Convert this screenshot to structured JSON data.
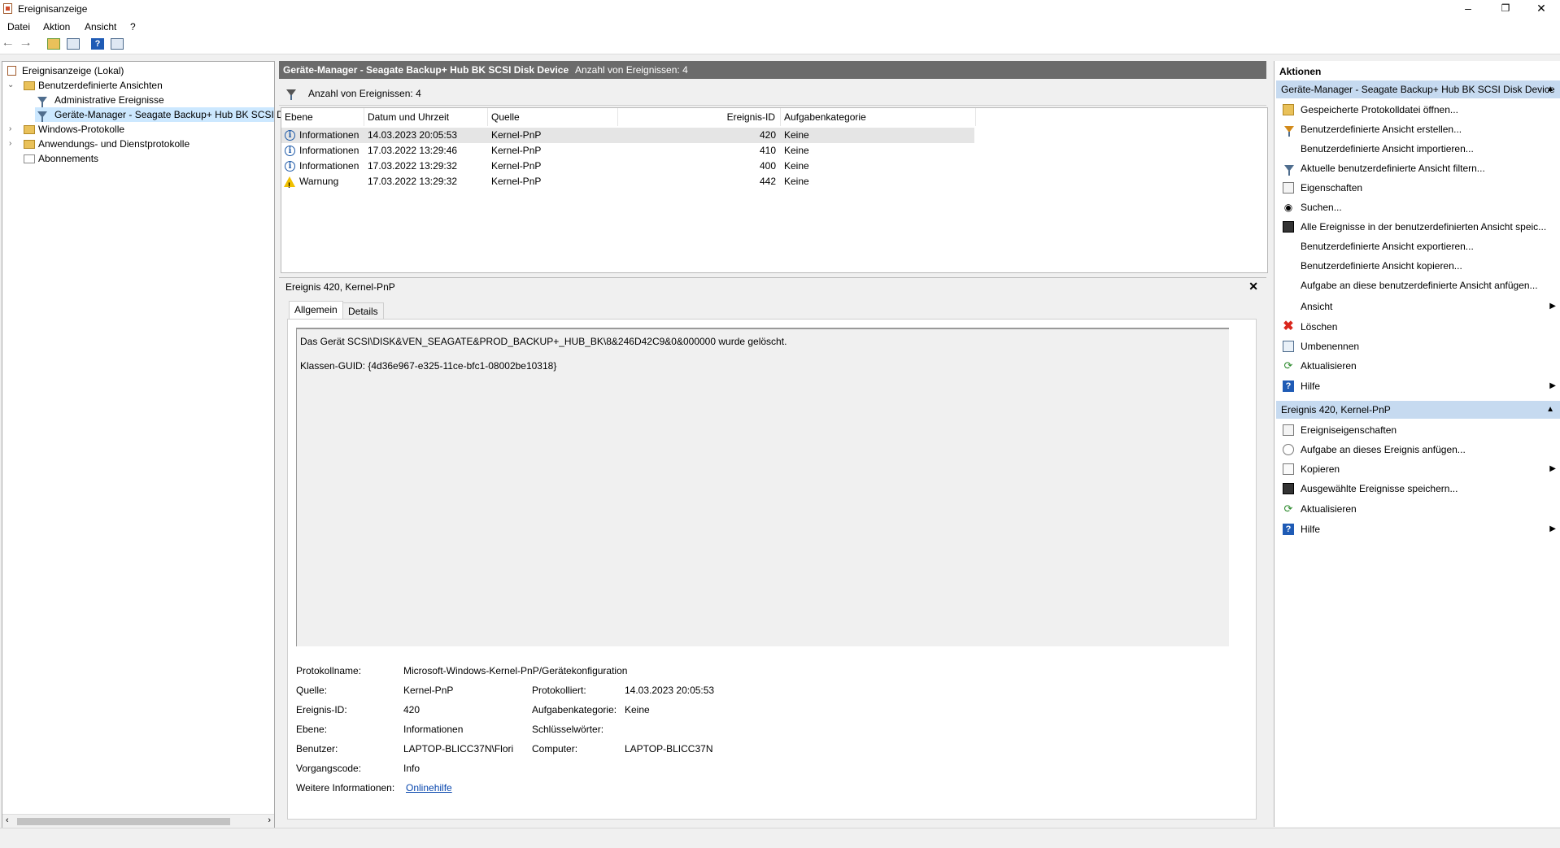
{
  "window": {
    "title": "Ereignisanzeige"
  },
  "menu": [
    "Datei",
    "Aktion",
    "Ansicht",
    "?"
  ],
  "tree": {
    "root": "Ereignisanzeige (Lokal)",
    "custom_views": "Benutzerdefinierte Ansichten",
    "admin_events": "Administrative Ereignisse",
    "device_view": "Geräte-Manager - Seagate Backup+ Hub BK SCSI Di",
    "windows_logs": "Windows-Protokolle",
    "app_logs": "Anwendungs- und Dienstprotokolle",
    "subscriptions": "Abonnements"
  },
  "center": {
    "title": "Geräte-Manager - Seagate Backup+ Hub BK SCSI Disk Device",
    "count_label": "Anzahl von Ereignissen: 4",
    "filter_text": "Anzahl von Ereignissen: 4",
    "columns": [
      "Ebene",
      "Datum und Uhrzeit",
      "Quelle",
      "Ereignis-ID",
      "Aufgabenkategorie"
    ],
    "rows": [
      {
        "level": "Informationen",
        "datetime": "14.03.2023 20:05:53",
        "source": "Kernel-PnP",
        "id": "420",
        "category": "Keine",
        "icon": "info-icon"
      },
      {
        "level": "Informationen",
        "datetime": "17.03.2022 13:29:46",
        "source": "Kernel-PnP",
        "id": "410",
        "category": "Keine",
        "icon": "info-icon"
      },
      {
        "level": "Informationen",
        "datetime": "17.03.2022 13:29:32",
        "source": "Kernel-PnP",
        "id": "400",
        "category": "Keine",
        "icon": "info-icon"
      },
      {
        "level": "Warnung",
        "datetime": "17.03.2022 13:29:32",
        "source": "Kernel-PnP",
        "id": "442",
        "category": "Keine",
        "icon": "warning-icon"
      }
    ]
  },
  "detail": {
    "title": "Ereignis 420, Kernel-PnP",
    "tabs": [
      "Allgemein",
      "Details"
    ],
    "message_line1": "Das Gerät SCSI\\DISK&VEN_SEAGATE&PROD_BACKUP+_HUB_BK\\8&246D42C9&0&000000 wurde gelöscht.",
    "message_line2": "Klassen-GUID: {4d36e967-e325-11ce-bfc1-08002be10318}",
    "props": {
      "log_name_label": "Protokollname:",
      "log_name": "Microsoft-Windows-Kernel-PnP/Gerätekonfiguration",
      "source_label": "Quelle:",
      "source": "Kernel-PnP",
      "logged_label": "Protokolliert:",
      "logged": "14.03.2023 20:05:53",
      "event_id_label": "Ereignis-ID:",
      "event_id": "420",
      "task_cat_label": "Aufgabenkategorie:",
      "task_cat": "Keine",
      "level_label": "Ebene:",
      "level": "Informationen",
      "keywords_label": "Schlüsselwörter:",
      "keywords": "",
      "user_label": "Benutzer:",
      "user": "LAPTOP-BLICC37N\\Flori",
      "computer_label": "Computer:",
      "computer": "LAPTOP-BLICC37N",
      "opcode_label": "Vorgangscode:",
      "opcode": "Info",
      "more_info_label": "Weitere Informationen:",
      "more_info": "Onlinehilfe"
    }
  },
  "actions": {
    "title": "Aktionen",
    "section1": "Geräte-Manager - Seagate Backup+ Hub BK SCSI Disk Device",
    "items1": [
      "Gespeicherte Protokolldatei öffnen...",
      "Benutzerdefinierte Ansicht erstellen...",
      "Benutzerdefinierte Ansicht importieren...",
      "Aktuelle benutzerdefinierte Ansicht filtern...",
      "Eigenschaften",
      "Suchen...",
      "Alle Ereignisse in der benutzerdefinierten Ansicht speic...",
      "Benutzerdefinierte Ansicht exportieren...",
      "Benutzerdefinierte Ansicht kopieren...",
      "Aufgabe an diese benutzerdefinierte Ansicht anfügen...",
      "Ansicht",
      "Löschen",
      "Umbenennen",
      "Aktualisieren",
      "Hilfe"
    ],
    "section2": "Ereignis 420, Kernel-PnP",
    "items2": [
      "Ereigniseigenschaften",
      "Aufgabe an dieses Ereignis anfügen...",
      "Kopieren",
      "Ausgewählte Ereignisse speichern...",
      "Aktualisieren",
      "Hilfe"
    ]
  }
}
